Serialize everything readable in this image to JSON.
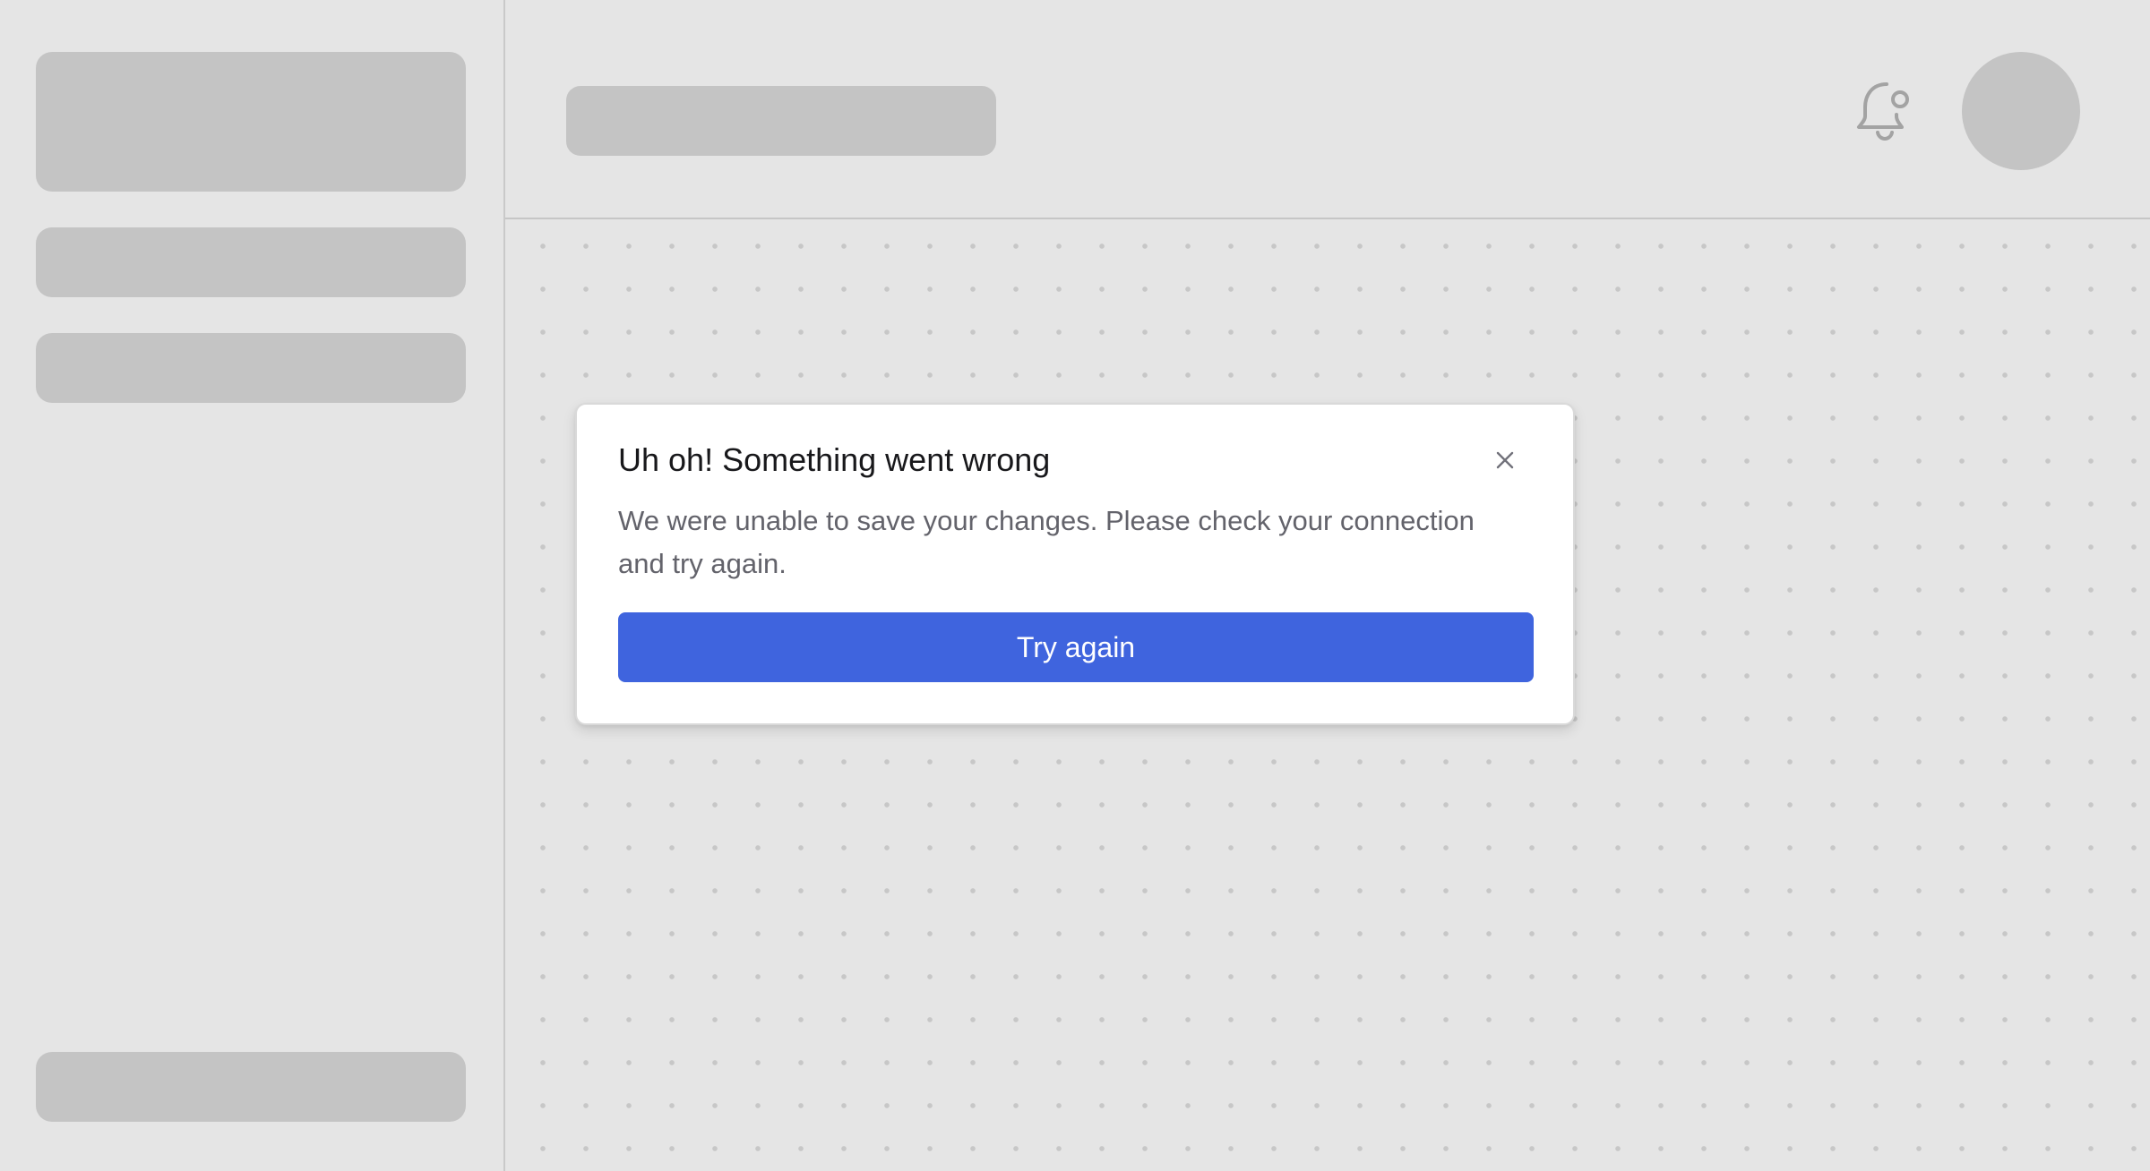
{
  "dialog": {
    "title": "Uh oh! Something went wrong",
    "message": "We were unable to save your changes. Please check your connection and try again.",
    "primary_button": "Try again",
    "close_icon": "close-icon"
  },
  "header": {
    "notification_icon": "bell-with-dot-icon"
  },
  "colors": {
    "background": "#e5e5e5",
    "skeleton": "#c4c4c4",
    "dialog_background": "#ffffff",
    "primary_button": "#3f64de",
    "title_text": "#18181b",
    "body_text": "#63636b"
  }
}
